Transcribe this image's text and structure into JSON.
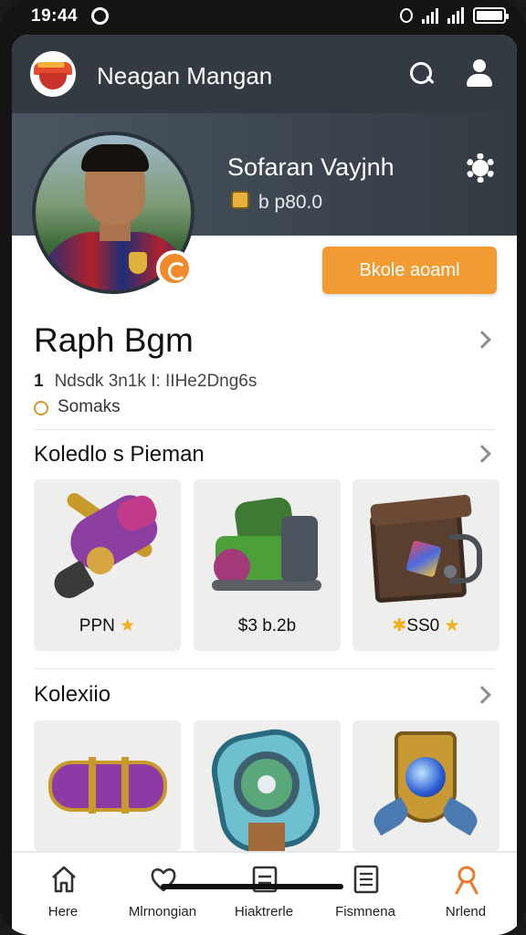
{
  "status_bar": {
    "time": "19:44"
  },
  "app": {
    "title": "Neagan Mangan"
  },
  "profile": {
    "name": "Sofaran Vayjnh",
    "coins": "b p80.0",
    "cta_label": "Bkole aoaml"
  },
  "main": {
    "title": "Raph Bgm",
    "stats_count": "1",
    "stats_text": "Ndsdk 3n1k I: IIHe2Dng6s",
    "sub_text": "Somaks"
  },
  "sections": [
    {
      "title": "Koledlo s  Pieman",
      "items": [
        {
          "label": "PPN",
          "icon": "star",
          "name": "Ornate spear shoe"
        },
        {
          "label": "$3 b.2b",
          "icon": "",
          "name": "Green boots"
        },
        {
          "label": "SS0",
          "icon": "star",
          "name": "Treasure chest"
        }
      ]
    },
    {
      "title": "Kolexiio",
      "items": [
        {
          "label": "",
          "icon": "",
          "name": "Purple gem"
        },
        {
          "label": "",
          "icon": "",
          "name": "Blue shield ring"
        },
        {
          "label": "",
          "icon": "",
          "name": "Trophy emblem"
        }
      ]
    }
  ],
  "bottom_nav": [
    {
      "label": "Here",
      "icon": "home-icon",
      "active": false
    },
    {
      "label": "Mlrnongian",
      "icon": "heart-icon",
      "active": false
    },
    {
      "label": "Hiaktrerle",
      "icon": "document-icon",
      "active": false
    },
    {
      "label": "Fismnena",
      "icon": "list-icon",
      "active": false
    },
    {
      "label": "Nrlend",
      "icon": "profile-icon",
      "active": true
    }
  ],
  "colors": {
    "accent": "#f29b33",
    "header": "#333a42",
    "active_nav": "#f07a2a"
  }
}
